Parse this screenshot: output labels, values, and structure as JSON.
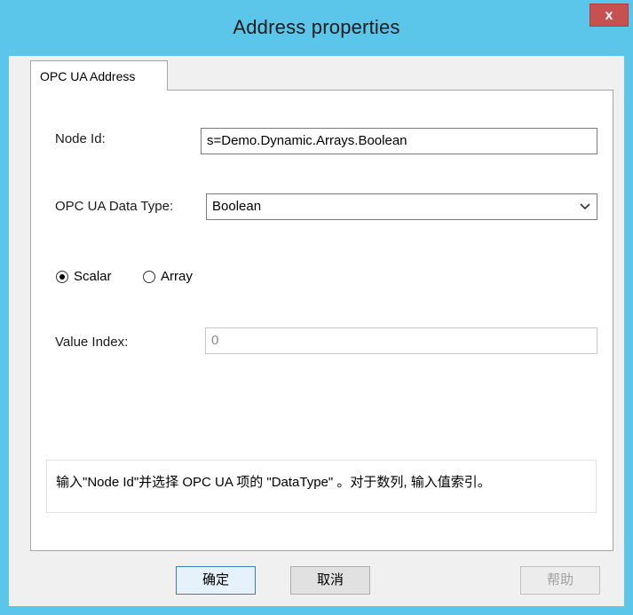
{
  "window": {
    "title": "Address properties",
    "close_label": "x"
  },
  "tabs": [
    {
      "label": "OPC UA Address",
      "selected": true
    }
  ],
  "form": {
    "node_id_label": "Node Id:",
    "node_id_value": "s=Demo.Dynamic.Arrays.Boolean",
    "data_type_label": "OPC UA Data Type:",
    "data_type_value": "Boolean",
    "radio_scalar_label": "Scalar",
    "radio_array_label": "Array",
    "selected_radio": "Scalar",
    "value_index_label": "Value Index:",
    "value_index_value": "0"
  },
  "info_text": "输入\"Node Id\"并选择 OPC UA 项的 \"DataType\" 。对于数列, 输入值索引。",
  "buttons": {
    "ok_label": "确定",
    "cancel_label": "取消",
    "help_label": "帮助"
  },
  "colors": {
    "titlebar": "#5bc6ea",
    "close_button": "#c75050"
  }
}
